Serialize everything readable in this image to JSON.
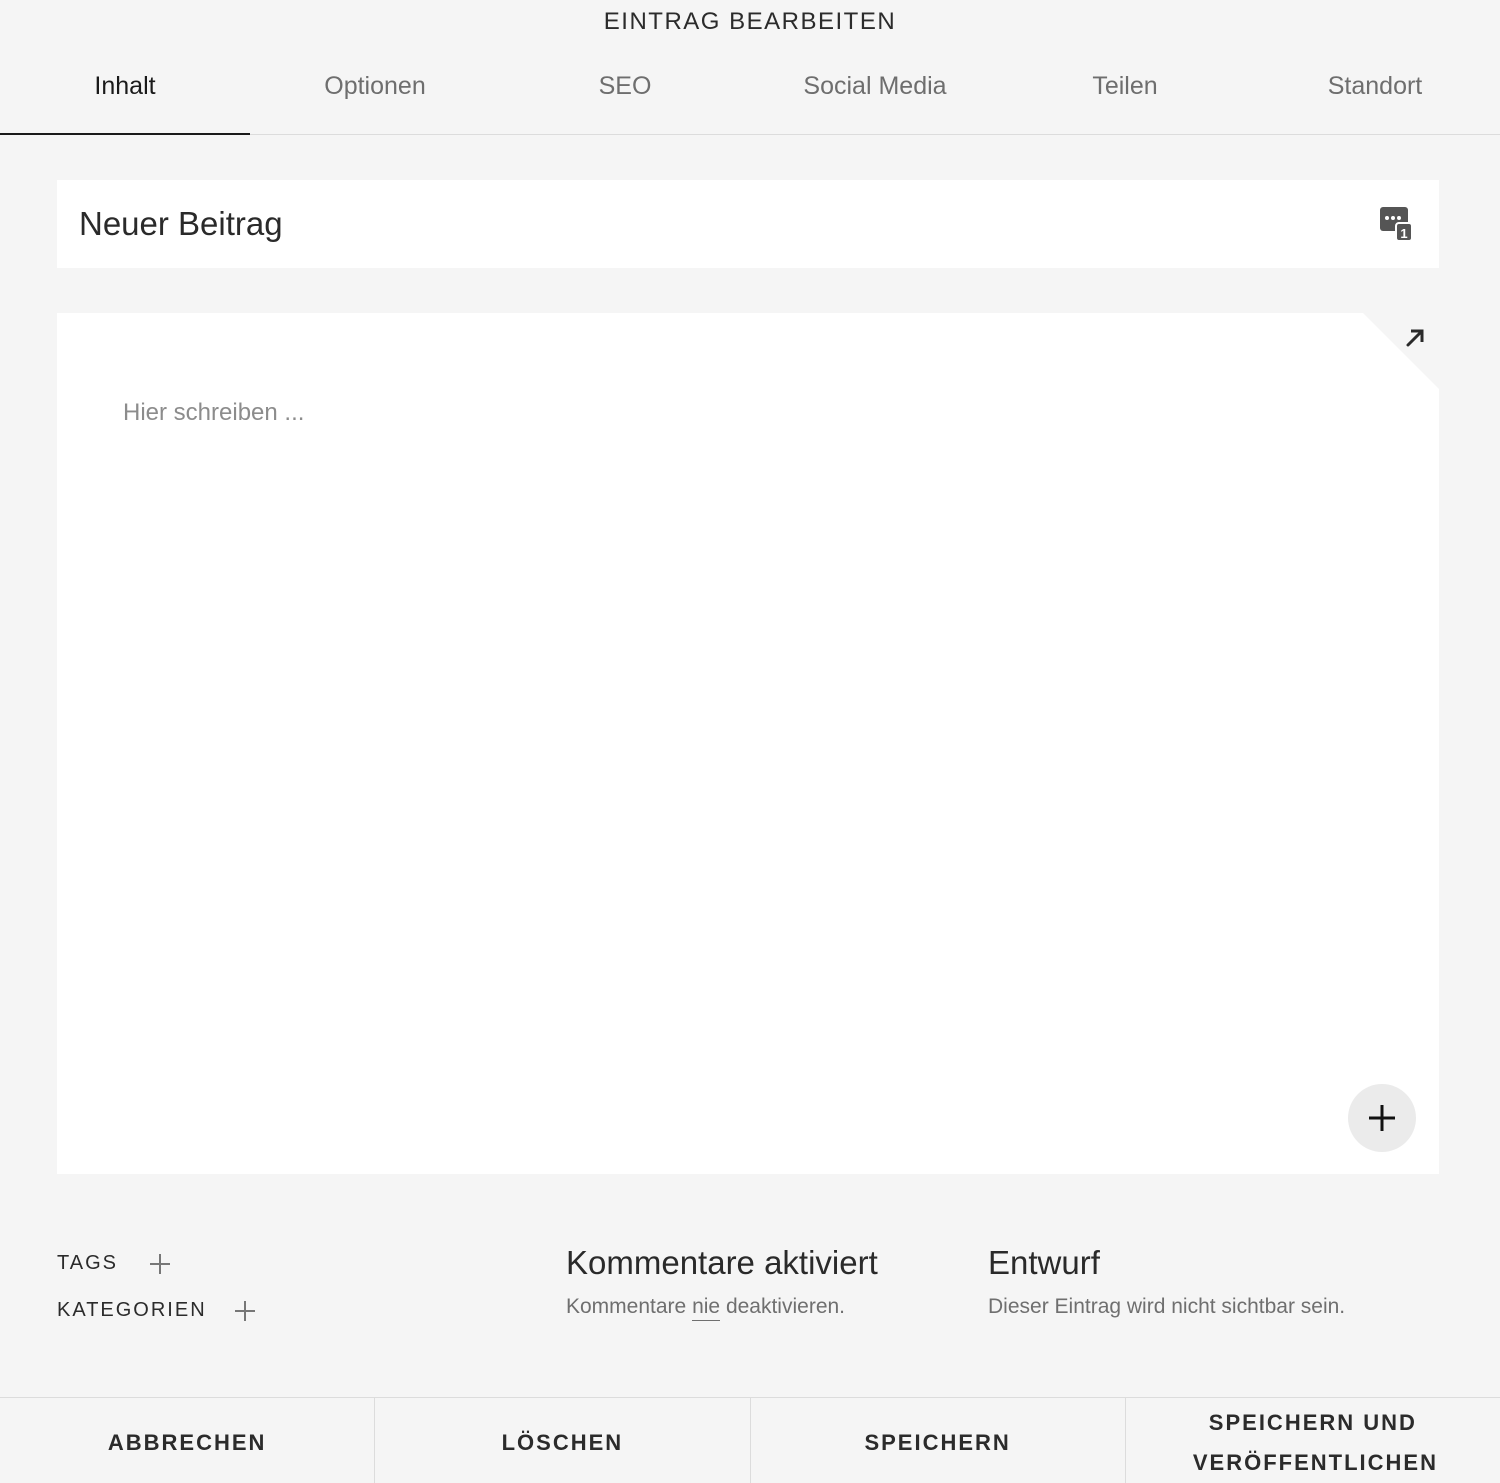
{
  "header": {
    "title": "EINTRAG BEARBEITEN"
  },
  "tabs": [
    {
      "label": "Inhalt",
      "active": true
    },
    {
      "label": "Optionen",
      "active": false
    },
    {
      "label": "SEO",
      "active": false
    },
    {
      "label": "Social Media",
      "active": false
    },
    {
      "label": "Teilen",
      "active": false
    },
    {
      "label": "Standort",
      "active": false
    }
  ],
  "post": {
    "title": "Neuer Beitrag",
    "title_icon": "comment-count-icon",
    "title_icon_count": "1"
  },
  "editor": {
    "placeholder": "Hier schreiben ...",
    "expand_icon": "expand-arrow-icon",
    "add_icon": "plus-icon"
  },
  "meta": {
    "tags_label": "TAGS",
    "categories_label": "KATEGORIEN"
  },
  "comments": {
    "heading": "Kommentare aktiviert",
    "sub_before": "Kommentare",
    "sub_link": "nie",
    "sub_after": "deaktivieren."
  },
  "status": {
    "heading": "Entwurf",
    "sub": "Dieser Eintrag wird nicht sichtbar sein."
  },
  "footer": {
    "cancel": "ABBRECHEN",
    "delete": "LÖSCHEN",
    "save": "SPEICHERN",
    "save_publish": "SPEICHERN UND VERÖFFENTLICHEN"
  },
  "colors": {
    "background": "#f5f5f5",
    "panel": "#ffffff",
    "text": "#1f1f1f",
    "muted": "#6f6f6f"
  }
}
